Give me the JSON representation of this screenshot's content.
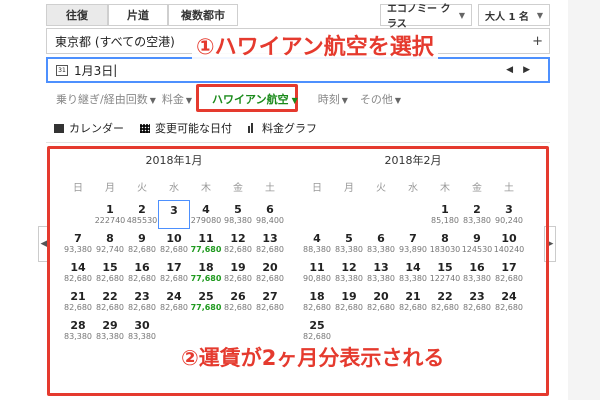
{
  "trip_types": [
    "往復",
    "片道",
    "複数都市"
  ],
  "cabin_class": "エコノミー クラス",
  "passengers": "大人 1 名",
  "origin": "東京都 (すべての空港)",
  "date_value": "1月3日",
  "filters": {
    "stops": "乗り継ぎ/経由回数",
    "price": "料金",
    "airline": "ハワイアン航空",
    "times": "時刻",
    "more": "その他"
  },
  "tools": {
    "calendar": "カレンダー",
    "flexible_dates": "変更可能な日付",
    "price_graph": "料金グラフ"
  },
  "weekdays": [
    "日",
    "月",
    "火",
    "水",
    "木",
    "金",
    "土"
  ],
  "months": [
    {
      "title": "2018年1月",
      "weeks": [
        [
          null,
          {
            "day": "1",
            "price": "222740"
          },
          {
            "day": "2",
            "price": "485530"
          },
          {
            "day": "3",
            "price": "",
            "selected": true
          },
          {
            "day": "4",
            "price": "279080"
          },
          {
            "day": "5",
            "price": "98,380"
          },
          {
            "day": "6",
            "price": "98,400"
          }
        ],
        [
          {
            "day": "7",
            "price": "93,380"
          },
          {
            "day": "8",
            "price": "92,740"
          },
          {
            "day": "9",
            "price": "82,680"
          },
          {
            "day": "10",
            "price": "82,680"
          },
          {
            "day": "11",
            "price": "77,680",
            "low": true
          },
          {
            "day": "12",
            "price": "82,680"
          },
          {
            "day": "13",
            "price": "82,680"
          }
        ],
        [
          {
            "day": "14",
            "price": "82,680"
          },
          {
            "day": "15",
            "price": "82,680"
          },
          {
            "day": "16",
            "price": "82,680"
          },
          {
            "day": "17",
            "price": "82,680"
          },
          {
            "day": "18",
            "price": "77,680",
            "low": true
          },
          {
            "day": "19",
            "price": "82,680"
          },
          {
            "day": "20",
            "price": "82,680"
          }
        ],
        [
          {
            "day": "21",
            "price": "82,680"
          },
          {
            "day": "22",
            "price": "82,680"
          },
          {
            "day": "23",
            "price": "82,680"
          },
          {
            "day": "24",
            "price": "82,680"
          },
          {
            "day": "25",
            "price": "77,680",
            "low": true
          },
          {
            "day": "26",
            "price": "82,680"
          },
          {
            "day": "27",
            "price": "82,680"
          }
        ],
        [
          {
            "day": "28",
            "price": "83,380"
          },
          {
            "day": "29",
            "price": "83,380"
          },
          {
            "day": "30",
            "price": "83,380"
          },
          null,
          null,
          null,
          null
        ]
      ]
    },
    {
      "title": "2018年2月",
      "weeks": [
        [
          null,
          null,
          null,
          null,
          {
            "day": "1",
            "price": "85,180"
          },
          {
            "day": "2",
            "price": "83,380"
          },
          {
            "day": "3",
            "price": "90,240"
          }
        ],
        [
          {
            "day": "4",
            "price": "88,380"
          },
          {
            "day": "5",
            "price": "83,380"
          },
          {
            "day": "6",
            "price": "83,380"
          },
          {
            "day": "7",
            "price": "93,890"
          },
          {
            "day": "8",
            "price": "183030"
          },
          {
            "day": "9",
            "price": "124530"
          },
          {
            "day": "10",
            "price": "140240"
          }
        ],
        [
          {
            "day": "11",
            "price": "90,880"
          },
          {
            "day": "12",
            "price": "83,380"
          },
          {
            "day": "13",
            "price": "83,380"
          },
          {
            "day": "14",
            "price": "83,380"
          },
          {
            "day": "15",
            "price": "122740"
          },
          {
            "day": "16",
            "price": "83,380"
          },
          {
            "day": "17",
            "price": "82,680"
          }
        ],
        [
          {
            "day": "18",
            "price": "82,680"
          },
          {
            "day": "19",
            "price": "82,680"
          },
          {
            "day": "20",
            "price": "82,680"
          },
          {
            "day": "21",
            "price": "82,680"
          },
          {
            "day": "22",
            "price": "82,680"
          },
          {
            "day": "23",
            "price": "82,680"
          },
          {
            "day": "24",
            "price": "82,680"
          }
        ],
        [
          {
            "day": "25",
            "price": "82,680"
          },
          null,
          null,
          null,
          null,
          null,
          null
        ]
      ]
    }
  ],
  "annotations": {
    "step1": "①ハワイアン航空を選択",
    "step2": "②運賃が2ヶ月分表示される"
  },
  "colors": {
    "accent_red": "#e53a2e",
    "low_price_green": "#1f9a1f",
    "focus_blue": "#4d90fe"
  },
  "icons": [
    "calendar-icon",
    "grid-icon",
    "bar-chart-icon",
    "chevron-left-icon",
    "chevron-right-icon",
    "plus-icon"
  ]
}
